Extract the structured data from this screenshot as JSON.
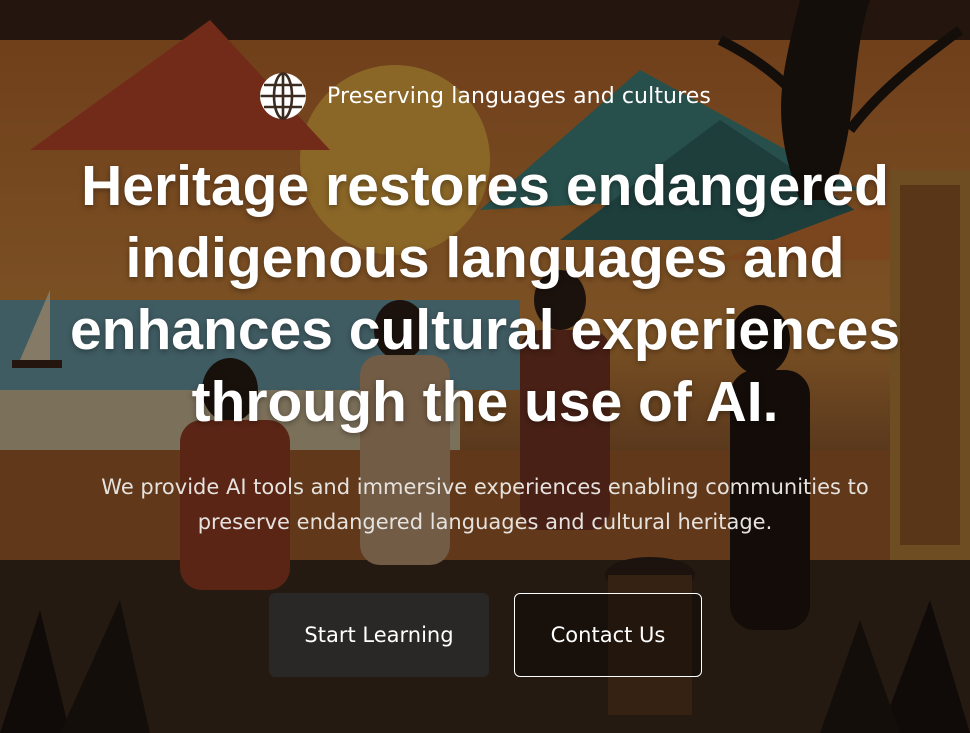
{
  "hero": {
    "tagline_icon": "globe-icon",
    "tagline": "Preserving languages and cultures",
    "headline_lines": [
      "Heritage restores endangered",
      "indigenous languages and",
      "enhances cultural experiences",
      "through the use of AI."
    ],
    "subheading_lines": [
      "We provide AI tools and immersive experiences enabling communities to",
      "preserve endangered languages and cultural heritage."
    ]
  },
  "buttons": {
    "primary_label": "Start Learning",
    "secondary_label": "Contact Us"
  },
  "colors": {
    "primary_button_bg": "#2a2727",
    "secondary_button_border": "#ffffff",
    "text": "#ffffff"
  }
}
